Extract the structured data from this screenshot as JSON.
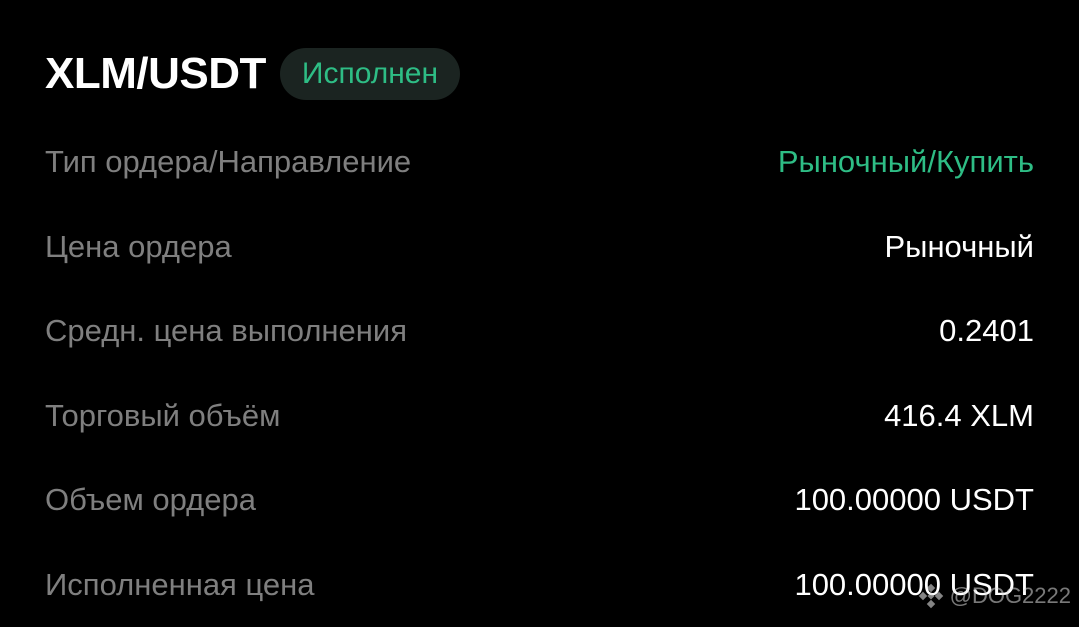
{
  "header": {
    "pair": "XLM/USDT",
    "status": "Исполнен"
  },
  "rows": [
    {
      "label": "Тип ордера/Направление",
      "value": "Рыночный/Купить",
      "accent": true
    },
    {
      "label": "Цена ордера",
      "value": "Рыночный"
    },
    {
      "label": "Средн. цена выполнения",
      "value": "0.2401"
    },
    {
      "label": "Торговый объём",
      "value": "416.4 XLM"
    },
    {
      "label": "Объем ордера",
      "value": "100.00000 USDT"
    },
    {
      "label": "Исполненная цена",
      "value": "100.00000 USDT"
    }
  ],
  "watermark": {
    "text": "@DOG2222"
  },
  "colors": {
    "accent": "#2ebd85",
    "background": "#000000",
    "label": "#7f7f7f"
  }
}
